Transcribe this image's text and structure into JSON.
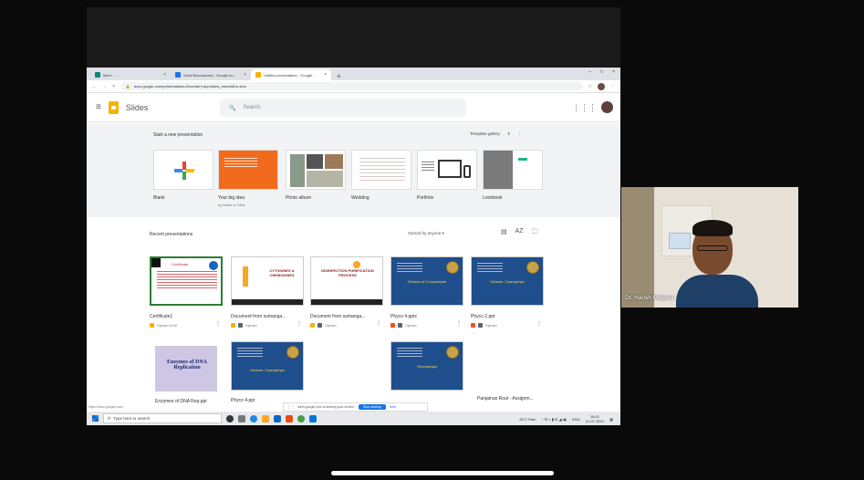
{
  "browser": {
    "tabs": [
      {
        "label": "Meet - ...",
        "color": "#00897b"
      },
      {
        "label": "Ganti Baccaloratsi - Google Ac...",
        "color": "#1a73e8"
      },
      {
        "label": "Untitled presentation - Google ...",
        "color": "#f4b400"
      }
    ],
    "new_tab": "+",
    "url": "docs.google.com/presentation/u/0/create?usp=slides_home&ths=true"
  },
  "app": {
    "title": "Slides",
    "search_placeholder": "Search"
  },
  "templates": {
    "heading": "Start a new presentation",
    "gallery_label": "Template gallery",
    "items": [
      {
        "label": "Blank",
        "sub": ""
      },
      {
        "label": "Your big idea",
        "sub": "by Made to Stick"
      },
      {
        "label": "Photo album",
        "sub": ""
      },
      {
        "label": "Wedding",
        "sub": ""
      },
      {
        "label": "Portfolio",
        "sub": ""
      },
      {
        "label": "Lookbook",
        "sub": ""
      }
    ]
  },
  "recent": {
    "heading": "Recent presentations",
    "owner_filter": "Owned by anyone",
    "row1": [
      {
        "name": "Certificate1",
        "meta": "Opened 15:30"
      },
      {
        "name": "Document from sumanga...",
        "meta": "Opened"
      },
      {
        "name": "Document from sumanga...",
        "meta": "Opened"
      },
      {
        "name": "Phyco 4.pptx",
        "meta": "Opened"
      },
      {
        "name": "Phyco 2.ppt",
        "meta": "Opened"
      }
    ],
    "row2": [
      {
        "name": "Enzymes of DNA Rep.ppt",
        "meta": ""
      },
      {
        "name": "Phyco 4.ppt",
        "meta": ""
      },
      {
        "name": "",
        "meta": ""
      },
      {
        "name": "",
        "meta": ""
      },
      {
        "name": "Panjatnas Rout - Assignm...",
        "meta": ""
      }
    ],
    "thumb_text": {
      "certificate": "Certificate",
      "cytokines": "CYTOKINES & CHEMOKINES",
      "disinfection": "DISINFECTION PURIFICATION PROCESS",
      "phyco4": "Division of Chrysophyta",
      "phyco2": "Division: Cyanophyta",
      "enzymes": "Enzymes of DNA Replication",
      "phyco4b": "Division: Cyanophyta",
      "rhodophyta": "Rhodophyta"
    }
  },
  "share_notice": {
    "text": "meet.google.com is sharing your screen.",
    "stop": "Stop sharing",
    "hide": "Hide"
  },
  "status_url": "https://docs.google.com/",
  "taskbar": {
    "search_placeholder": "Type here to search",
    "weather": "26°C Rain",
    "lang": "ENG",
    "time": "16:01",
    "date": "21-07-2021"
  },
  "video": {
    "participant_name": "Dr. Harish Malpani"
  }
}
